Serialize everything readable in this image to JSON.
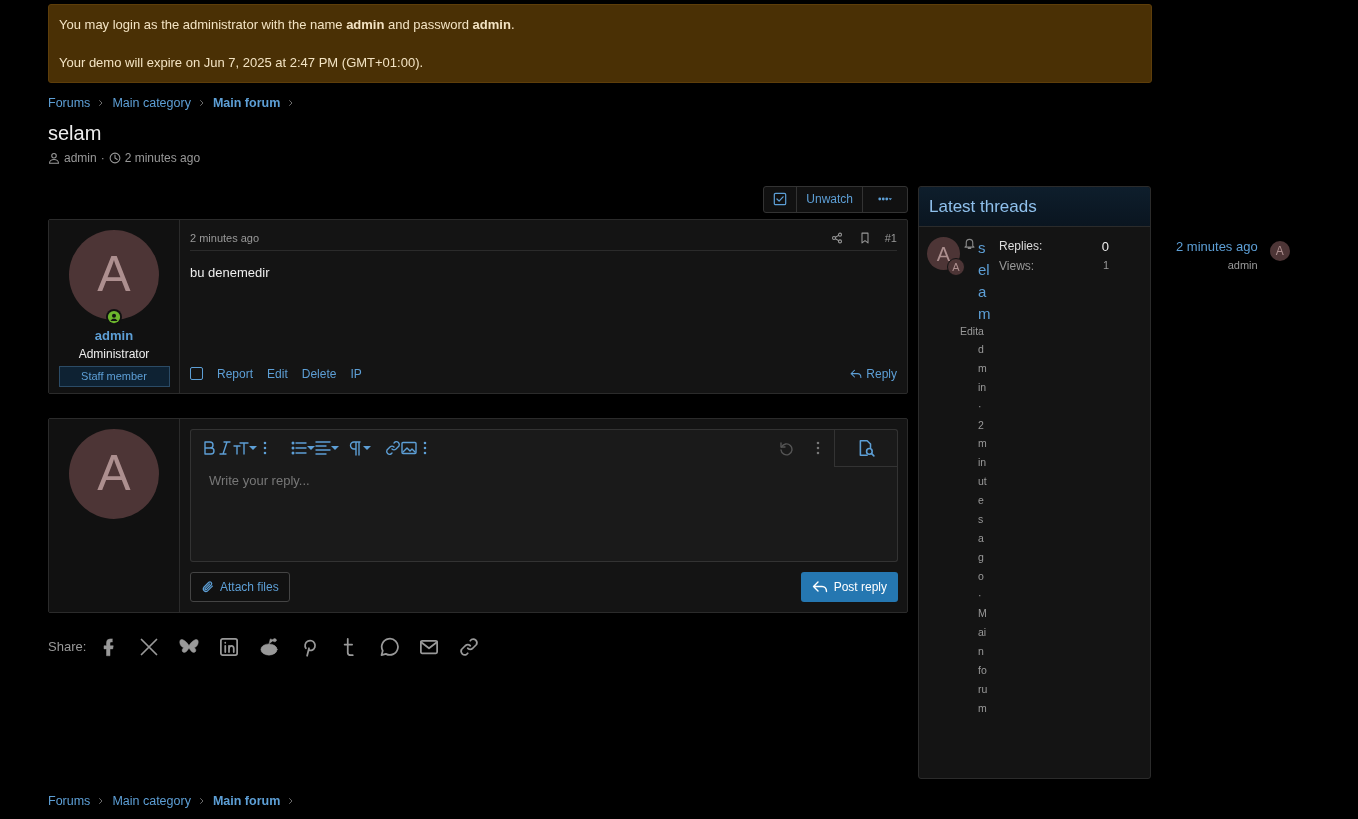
{
  "notice": {
    "lines": [
      "You may login as the administrator with the name **admin** and password **admin**.",
      "Your demo will expire on Jun 7, 2025 at 2:47 PM (GMT+01:00)."
    ]
  },
  "breadcrumb": [
    {
      "label": "Forums",
      "current": false
    },
    {
      "label": "Main category",
      "current": false
    },
    {
      "label": "Main forum",
      "current": true
    }
  ],
  "thread": {
    "title": "selam",
    "author": "admin",
    "separator": "·",
    "time": "2 minutes ago"
  },
  "thread_actions": {
    "watch": "Unwatch"
  },
  "post": {
    "time": "2 minutes ago",
    "number": "#1",
    "body": "bu denemedir",
    "selected": false,
    "user": {
      "initial": "A",
      "name": "admin",
      "title": "Administrator",
      "badge": "Staff member",
      "online": true
    },
    "actions": [
      "Report",
      "Edit",
      "Delete",
      "IP"
    ],
    "reply": "Reply"
  },
  "editor": {
    "initial": "A",
    "placeholder": "Write your reply...",
    "attach": "Attach files",
    "submit": "Post reply"
  },
  "share": {
    "label": "Share:"
  },
  "sidebar": {
    "title": "Latest threads",
    "threads": [
      {
        "initial": "A",
        "sub_initial": "A",
        "title": "selam",
        "edited": "Edita",
        "meta": "dmin · 2 minutes ago · Main forum",
        "stats": [
          {
            "label": "Replies:",
            "value": "0"
          },
          {
            "label": "Views:",
            "value": "1"
          }
        ],
        "last_time": "2 minutes ago",
        "last_user": "admin",
        "last_initial": "A"
      }
    ]
  },
  "footer_breadcrumb": [
    {
      "label": "Forums",
      "current": false
    },
    {
      "label": "Main category",
      "current": false
    },
    {
      "label": "Main forum",
      "current": true
    }
  ]
}
